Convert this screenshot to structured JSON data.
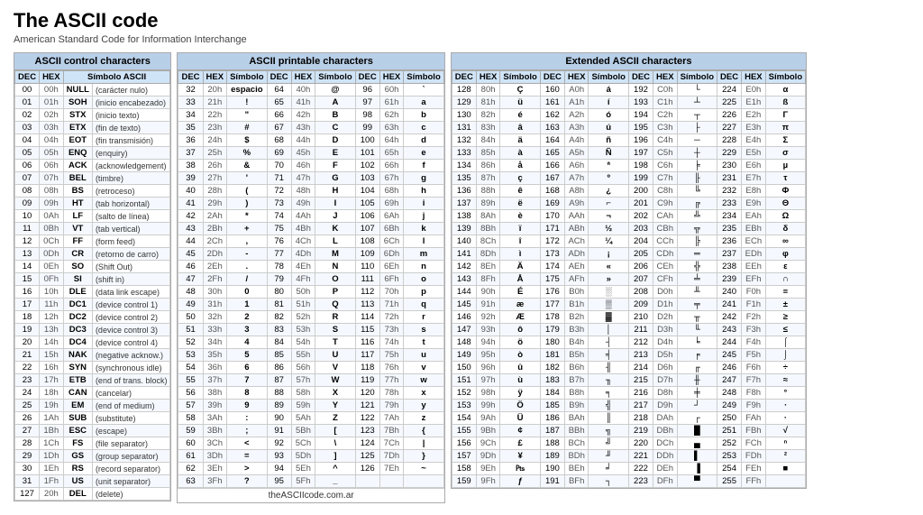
{
  "title": "The ASCII code",
  "subtitle": "American Standard Code for Information Interchange",
  "footer_url": "theASCIIcode.com.ar",
  "control_section_title": "ASCII control characters",
  "printable_section_title": "ASCII printable characters",
  "extended_section_title": "Extended ASCII characters",
  "control_headers": [
    "DEC",
    "HEX",
    "Símbolo ASCII"
  ],
  "printable_headers": [
    "DEC",
    "HEX",
    "Símbolo"
  ],
  "extended_headers": [
    "DEC",
    "HEX",
    "Símbolo"
  ],
  "control_rows": [
    [
      "00",
      "00h",
      "NULL",
      "(carácter nulo)"
    ],
    [
      "01",
      "01h",
      "SOH",
      "(inicio encabezado)"
    ],
    [
      "02",
      "02h",
      "STX",
      "(inicio texto)"
    ],
    [
      "03",
      "03h",
      "ETX",
      "(fin de texto)"
    ],
    [
      "04",
      "04h",
      "EOT",
      "(fin transmisión)"
    ],
    [
      "05",
      "05h",
      "ENQ",
      "(enquiry)"
    ],
    [
      "06",
      "06h",
      "ACK",
      "(acknowledgement)"
    ],
    [
      "07",
      "07h",
      "BEL",
      "(timbre)"
    ],
    [
      "08",
      "08h",
      "BS",
      "(retroceso)"
    ],
    [
      "09",
      "09h",
      "HT",
      "(tab horizontal)"
    ],
    [
      "10",
      "0Ah",
      "LF",
      "(salto de línea)"
    ],
    [
      "11",
      "0Bh",
      "VT",
      "(tab vertical)"
    ],
    [
      "12",
      "0Ch",
      "FF",
      "(form feed)"
    ],
    [
      "13",
      "0Dh",
      "CR",
      "(retorno de carro)"
    ],
    [
      "14",
      "0Eh",
      "SO",
      "(Shift Out)"
    ],
    [
      "15",
      "0Fh",
      "SI",
      "(shift in)"
    ],
    [
      "16",
      "10h",
      "DLE",
      "(data link escape)"
    ],
    [
      "17",
      "11h",
      "DC1",
      "(device control 1)"
    ],
    [
      "18",
      "12h",
      "DC2",
      "(device control 2)"
    ],
    [
      "19",
      "13h",
      "DC3",
      "(device control 3)"
    ],
    [
      "20",
      "14h",
      "DC4",
      "(device control 4)"
    ],
    [
      "21",
      "15h",
      "NAK",
      "(negative acknow.)"
    ],
    [
      "22",
      "16h",
      "SYN",
      "(synchronous idle)"
    ],
    [
      "23",
      "17h",
      "ETB",
      "(end of trans. block)"
    ],
    [
      "24",
      "18h",
      "CAN",
      "(cancelar)"
    ],
    [
      "25",
      "19h",
      "EM",
      "(end of medium)"
    ],
    [
      "26",
      "1Ah",
      "SUB",
      "(substitute)"
    ],
    [
      "27",
      "1Bh",
      "ESC",
      "(escape)"
    ],
    [
      "28",
      "1Ch",
      "FS",
      "(file separator)"
    ],
    [
      "29",
      "1Dh",
      "GS",
      "(group separator)"
    ],
    [
      "30",
      "1Eh",
      "RS",
      "(record separator)"
    ],
    [
      "31",
      "1Fh",
      "US",
      "(unit separator)"
    ],
    [
      "127",
      "20h",
      "DEL",
      "(delete)"
    ]
  ],
  "printable_rows": [
    [
      [
        "32",
        "20h",
        "espacio"
      ],
      [
        "64",
        "40h",
        "@"
      ],
      [
        "96",
        "60h",
        "`"
      ]
    ],
    [
      [
        "33",
        "21h",
        "!"
      ],
      [
        "65",
        "41h",
        "A"
      ],
      [
        "97",
        "61h",
        "a"
      ]
    ],
    [
      [
        "34",
        "22h",
        "\""
      ],
      [
        "66",
        "42h",
        "B"
      ],
      [
        "98",
        "62h",
        "b"
      ]
    ],
    [
      [
        "35",
        "23h",
        "#"
      ],
      [
        "67",
        "43h",
        "C"
      ],
      [
        "99",
        "63h",
        "c"
      ]
    ],
    [
      [
        "36",
        "24h",
        "$"
      ],
      [
        "68",
        "44h",
        "D"
      ],
      [
        "100",
        "64h",
        "d"
      ]
    ],
    [
      [
        "37",
        "25h",
        "%"
      ],
      [
        "69",
        "45h",
        "E"
      ],
      [
        "101",
        "65h",
        "e"
      ]
    ],
    [
      [
        "38",
        "26h",
        "&"
      ],
      [
        "70",
        "46h",
        "F"
      ],
      [
        "102",
        "66h",
        "f"
      ]
    ],
    [
      [
        "39",
        "27h",
        "'"
      ],
      [
        "71",
        "47h",
        "G"
      ],
      [
        "103",
        "67h",
        "g"
      ]
    ],
    [
      [
        "40",
        "28h",
        "("
      ],
      [
        "72",
        "48h",
        "H"
      ],
      [
        "104",
        "68h",
        "h"
      ]
    ],
    [
      [
        "41",
        "29h",
        ")"
      ],
      [
        "73",
        "49h",
        "I"
      ],
      [
        "105",
        "69h",
        "i"
      ]
    ],
    [
      [
        "42",
        "2Ah",
        "*"
      ],
      [
        "74",
        "4Ah",
        "J"
      ],
      [
        "106",
        "6Ah",
        "j"
      ]
    ],
    [
      [
        "43",
        "2Bh",
        "+"
      ],
      [
        "75",
        "4Bh",
        "K"
      ],
      [
        "107",
        "6Bh",
        "k"
      ]
    ],
    [
      [
        "44",
        "2Ch",
        ","
      ],
      [
        "76",
        "4Ch",
        "L"
      ],
      [
        "108",
        "6Ch",
        "l"
      ]
    ],
    [
      [
        "45",
        "2Dh",
        "-"
      ],
      [
        "77",
        "4Dh",
        "M"
      ],
      [
        "109",
        "6Dh",
        "m"
      ]
    ],
    [
      [
        "46",
        "2Eh",
        "."
      ],
      [
        "78",
        "4Eh",
        "N"
      ],
      [
        "110",
        "6Eh",
        "n"
      ]
    ],
    [
      [
        "47",
        "2Fh",
        "/"
      ],
      [
        "79",
        "4Fh",
        "O"
      ],
      [
        "111",
        "6Fh",
        "o"
      ]
    ],
    [
      [
        "48",
        "30h",
        "0"
      ],
      [
        "80",
        "50h",
        "P"
      ],
      [
        "112",
        "70h",
        "p"
      ]
    ],
    [
      [
        "49",
        "31h",
        "1"
      ],
      [
        "81",
        "51h",
        "Q"
      ],
      [
        "113",
        "71h",
        "q"
      ]
    ],
    [
      [
        "50",
        "32h",
        "2"
      ],
      [
        "82",
        "52h",
        "R"
      ],
      [
        "114",
        "72h",
        "r"
      ]
    ],
    [
      [
        "51",
        "33h",
        "3"
      ],
      [
        "83",
        "53h",
        "S"
      ],
      [
        "115",
        "73h",
        "s"
      ]
    ],
    [
      [
        "52",
        "34h",
        "4"
      ],
      [
        "84",
        "54h",
        "T"
      ],
      [
        "116",
        "74h",
        "t"
      ]
    ],
    [
      [
        "53",
        "35h",
        "5"
      ],
      [
        "85",
        "55h",
        "U"
      ],
      [
        "117",
        "75h",
        "u"
      ]
    ],
    [
      [
        "54",
        "36h",
        "6"
      ],
      [
        "86",
        "56h",
        "V"
      ],
      [
        "118",
        "76h",
        "v"
      ]
    ],
    [
      [
        "55",
        "37h",
        "7"
      ],
      [
        "87",
        "57h",
        "W"
      ],
      [
        "119",
        "77h",
        "w"
      ]
    ],
    [
      [
        "56",
        "38h",
        "8"
      ],
      [
        "88",
        "58h",
        "X"
      ],
      [
        "120",
        "78h",
        "x"
      ]
    ],
    [
      [
        "57",
        "39h",
        "9"
      ],
      [
        "89",
        "59h",
        "Y"
      ],
      [
        "121",
        "79h",
        "y"
      ]
    ],
    [
      [
        "58",
        "3Ah",
        ":"
      ],
      [
        "90",
        "5Ah",
        "Z"
      ],
      [
        "122",
        "7Ah",
        "z"
      ]
    ],
    [
      [
        "59",
        "3Bh",
        ";"
      ],
      [
        "91",
        "5Bh",
        "["
      ],
      [
        "123",
        "7Bh",
        "{"
      ]
    ],
    [
      [
        "60",
        "3Ch",
        "<"
      ],
      [
        "92",
        "5Ch",
        "\\"
      ],
      [
        "124",
        "7Ch",
        "|"
      ]
    ],
    [
      [
        "61",
        "3Dh",
        "="
      ],
      [
        "93",
        "5Dh",
        "]"
      ],
      [
        "125",
        "7Dh",
        "}"
      ]
    ],
    [
      [
        "62",
        "3Eh",
        ">"
      ],
      [
        "94",
        "5Eh",
        "^"
      ],
      [
        "126",
        "7Eh",
        "~"
      ]
    ],
    [
      [
        "63",
        "3Fh",
        "?"
      ],
      [
        "95",
        "5Fh",
        "_"
      ],
      [
        "",
        "",
        ""
      ]
    ]
  ],
  "extended_col1": [
    [
      "128",
      "80h",
      "Ç"
    ],
    [
      "129",
      "81h",
      "ü"
    ],
    [
      "130",
      "82h",
      "é"
    ],
    [
      "131",
      "83h",
      "â"
    ],
    [
      "132",
      "84h",
      "ä"
    ],
    [
      "133",
      "85h",
      "à"
    ],
    [
      "134",
      "86h",
      "å"
    ],
    [
      "135",
      "87h",
      "ç"
    ],
    [
      "136",
      "88h",
      "ê"
    ],
    [
      "137",
      "89h",
      "ë"
    ],
    [
      "138",
      "8Ah",
      "è"
    ],
    [
      "139",
      "8Bh",
      "ï"
    ],
    [
      "140",
      "8Ch",
      "î"
    ],
    [
      "141",
      "8Dh",
      "ì"
    ],
    [
      "142",
      "8Eh",
      "Ä"
    ],
    [
      "143",
      "8Fh",
      "Å"
    ],
    [
      "144",
      "90h",
      "É"
    ],
    [
      "145",
      "91h",
      "æ"
    ],
    [
      "146",
      "92h",
      "Æ"
    ],
    [
      "147",
      "93h",
      "ô"
    ],
    [
      "148",
      "94h",
      "ö"
    ],
    [
      "149",
      "95h",
      "ò"
    ],
    [
      "150",
      "96h",
      "û"
    ],
    [
      "151",
      "97h",
      "ù"
    ],
    [
      "152",
      "98h",
      "ÿ"
    ],
    [
      "153",
      "99h",
      "Ö"
    ],
    [
      "154",
      "9Ah",
      "Ü"
    ],
    [
      "155",
      "9Bh",
      "¢"
    ],
    [
      "156",
      "9Ch",
      "£"
    ],
    [
      "157",
      "9Dh",
      "¥"
    ],
    [
      "158",
      "9Eh",
      "₧"
    ],
    [
      "159",
      "9Fh",
      "ƒ"
    ]
  ],
  "extended_col2": [
    [
      "160",
      "A0h",
      "á"
    ],
    [
      "161",
      "A1h",
      "í"
    ],
    [
      "162",
      "A2h",
      "ó"
    ],
    [
      "163",
      "A3h",
      "ú"
    ],
    [
      "164",
      "A4h",
      "ñ"
    ],
    [
      "165",
      "A5h",
      "Ñ"
    ],
    [
      "166",
      "A6h",
      "ª"
    ],
    [
      "167",
      "A7h",
      "º"
    ],
    [
      "168",
      "A8h",
      "¿"
    ],
    [
      "169",
      "A9h",
      "⌐"
    ],
    [
      "170",
      "AAh",
      "¬"
    ],
    [
      "171",
      "ABh",
      "½"
    ],
    [
      "172",
      "ACh",
      "¼"
    ],
    [
      "173",
      "ADh",
      "¡"
    ],
    [
      "174",
      "AEh",
      "«"
    ],
    [
      "175",
      "AFh",
      "»"
    ],
    [
      "176",
      "B0h",
      "░"
    ],
    [
      "177",
      "B1h",
      "▒"
    ],
    [
      "178",
      "B2h",
      "▓"
    ],
    [
      "179",
      "B3h",
      "│"
    ],
    [
      "180",
      "B4h",
      "┤"
    ],
    [
      "181",
      "B5h",
      "╡"
    ],
    [
      "182",
      "B6h",
      "╢"
    ],
    [
      "183",
      "B7h",
      "╖"
    ],
    [
      "184",
      "B8h",
      "╕"
    ],
    [
      "185",
      "B9h",
      "╣"
    ],
    [
      "186",
      "BAh",
      "║"
    ],
    [
      "187",
      "BBh",
      "╗"
    ],
    [
      "188",
      "BCh",
      "╝"
    ],
    [
      "189",
      "BDh",
      "╜"
    ],
    [
      "190",
      "BEh",
      "╛"
    ],
    [
      "191",
      "BFh",
      "┐"
    ]
  ],
  "extended_col3": [
    [
      "192",
      "C0h",
      "└"
    ],
    [
      "193",
      "C1h",
      "┴"
    ],
    [
      "194",
      "C2h",
      "┬"
    ],
    [
      "195",
      "C3h",
      "├"
    ],
    [
      "196",
      "C4h",
      "─"
    ],
    [
      "197",
      "C5h",
      "┼"
    ],
    [
      "198",
      "C6h",
      "╞"
    ],
    [
      "199",
      "C7h",
      "╟"
    ],
    [
      "200",
      "C8h",
      "╚"
    ],
    [
      "201",
      "C9h",
      "╔"
    ],
    [
      "202",
      "CAh",
      "╩"
    ],
    [
      "203",
      "CBh",
      "╦"
    ],
    [
      "204",
      "CCh",
      "╠"
    ],
    [
      "205",
      "CDh",
      "═"
    ],
    [
      "206",
      "CEh",
      "╬"
    ],
    [
      "207",
      "CFh",
      "╧"
    ],
    [
      "208",
      "D0h",
      "╨"
    ],
    [
      "209",
      "D1h",
      "╤"
    ],
    [
      "210",
      "D2h",
      "╥"
    ],
    [
      "211",
      "D3h",
      "╙"
    ],
    [
      "212",
      "D4h",
      "╘"
    ],
    [
      "213",
      "D5h",
      "╒"
    ],
    [
      "214",
      "D6h",
      "╓"
    ],
    [
      "215",
      "D7h",
      "╫"
    ],
    [
      "216",
      "D8h",
      "╪"
    ],
    [
      "217",
      "D9h",
      "┘"
    ],
    [
      "218",
      "DAh",
      "┌"
    ],
    [
      "219",
      "DBh",
      "█"
    ],
    [
      "220",
      "DCh",
      "▄"
    ],
    [
      "221",
      "DDh",
      "▌"
    ],
    [
      "222",
      "DEh",
      "▐"
    ],
    [
      "223",
      "DFh",
      "▀"
    ]
  ],
  "extended_col4": [
    [
      "224",
      "E0h",
      "α"
    ],
    [
      "225",
      "E1h",
      "ß"
    ],
    [
      "226",
      "E2h",
      "Γ"
    ],
    [
      "227",
      "E3h",
      "π"
    ],
    [
      "228",
      "E4h",
      "Σ"
    ],
    [
      "229",
      "E5h",
      "σ"
    ],
    [
      "230",
      "E6h",
      "µ"
    ],
    [
      "231",
      "E7h",
      "τ"
    ],
    [
      "232",
      "E8h",
      "Φ"
    ],
    [
      "233",
      "E9h",
      "Θ"
    ],
    [
      "234",
      "EAh",
      "Ω"
    ],
    [
      "235",
      "EBh",
      "δ"
    ],
    [
      "236",
      "ECh",
      "∞"
    ],
    [
      "237",
      "EDh",
      "φ"
    ],
    [
      "238",
      "EEh",
      "ε"
    ],
    [
      "239",
      "EFh",
      "∩"
    ],
    [
      "240",
      "F0h",
      "≡"
    ],
    [
      "241",
      "F1h",
      "±"
    ],
    [
      "242",
      "F2h",
      "≥"
    ],
    [
      "243",
      "F3h",
      "≤"
    ],
    [
      "244",
      "F4h",
      "⌠"
    ],
    [
      "245",
      "F5h",
      "⌡"
    ],
    [
      "246",
      "F6h",
      "÷"
    ],
    [
      "247",
      "F7h",
      "≈"
    ],
    [
      "248",
      "F8h",
      "°"
    ],
    [
      "249",
      "F9h",
      "∙"
    ],
    [
      "250",
      "FAh",
      "·"
    ],
    [
      "251",
      "FBh",
      "√"
    ],
    [
      "252",
      "FCh",
      "ⁿ"
    ],
    [
      "253",
      "FDh",
      "²"
    ],
    [
      "254",
      "FEh",
      "■"
    ],
    [
      "255",
      "FFh",
      ""
    ]
  ]
}
